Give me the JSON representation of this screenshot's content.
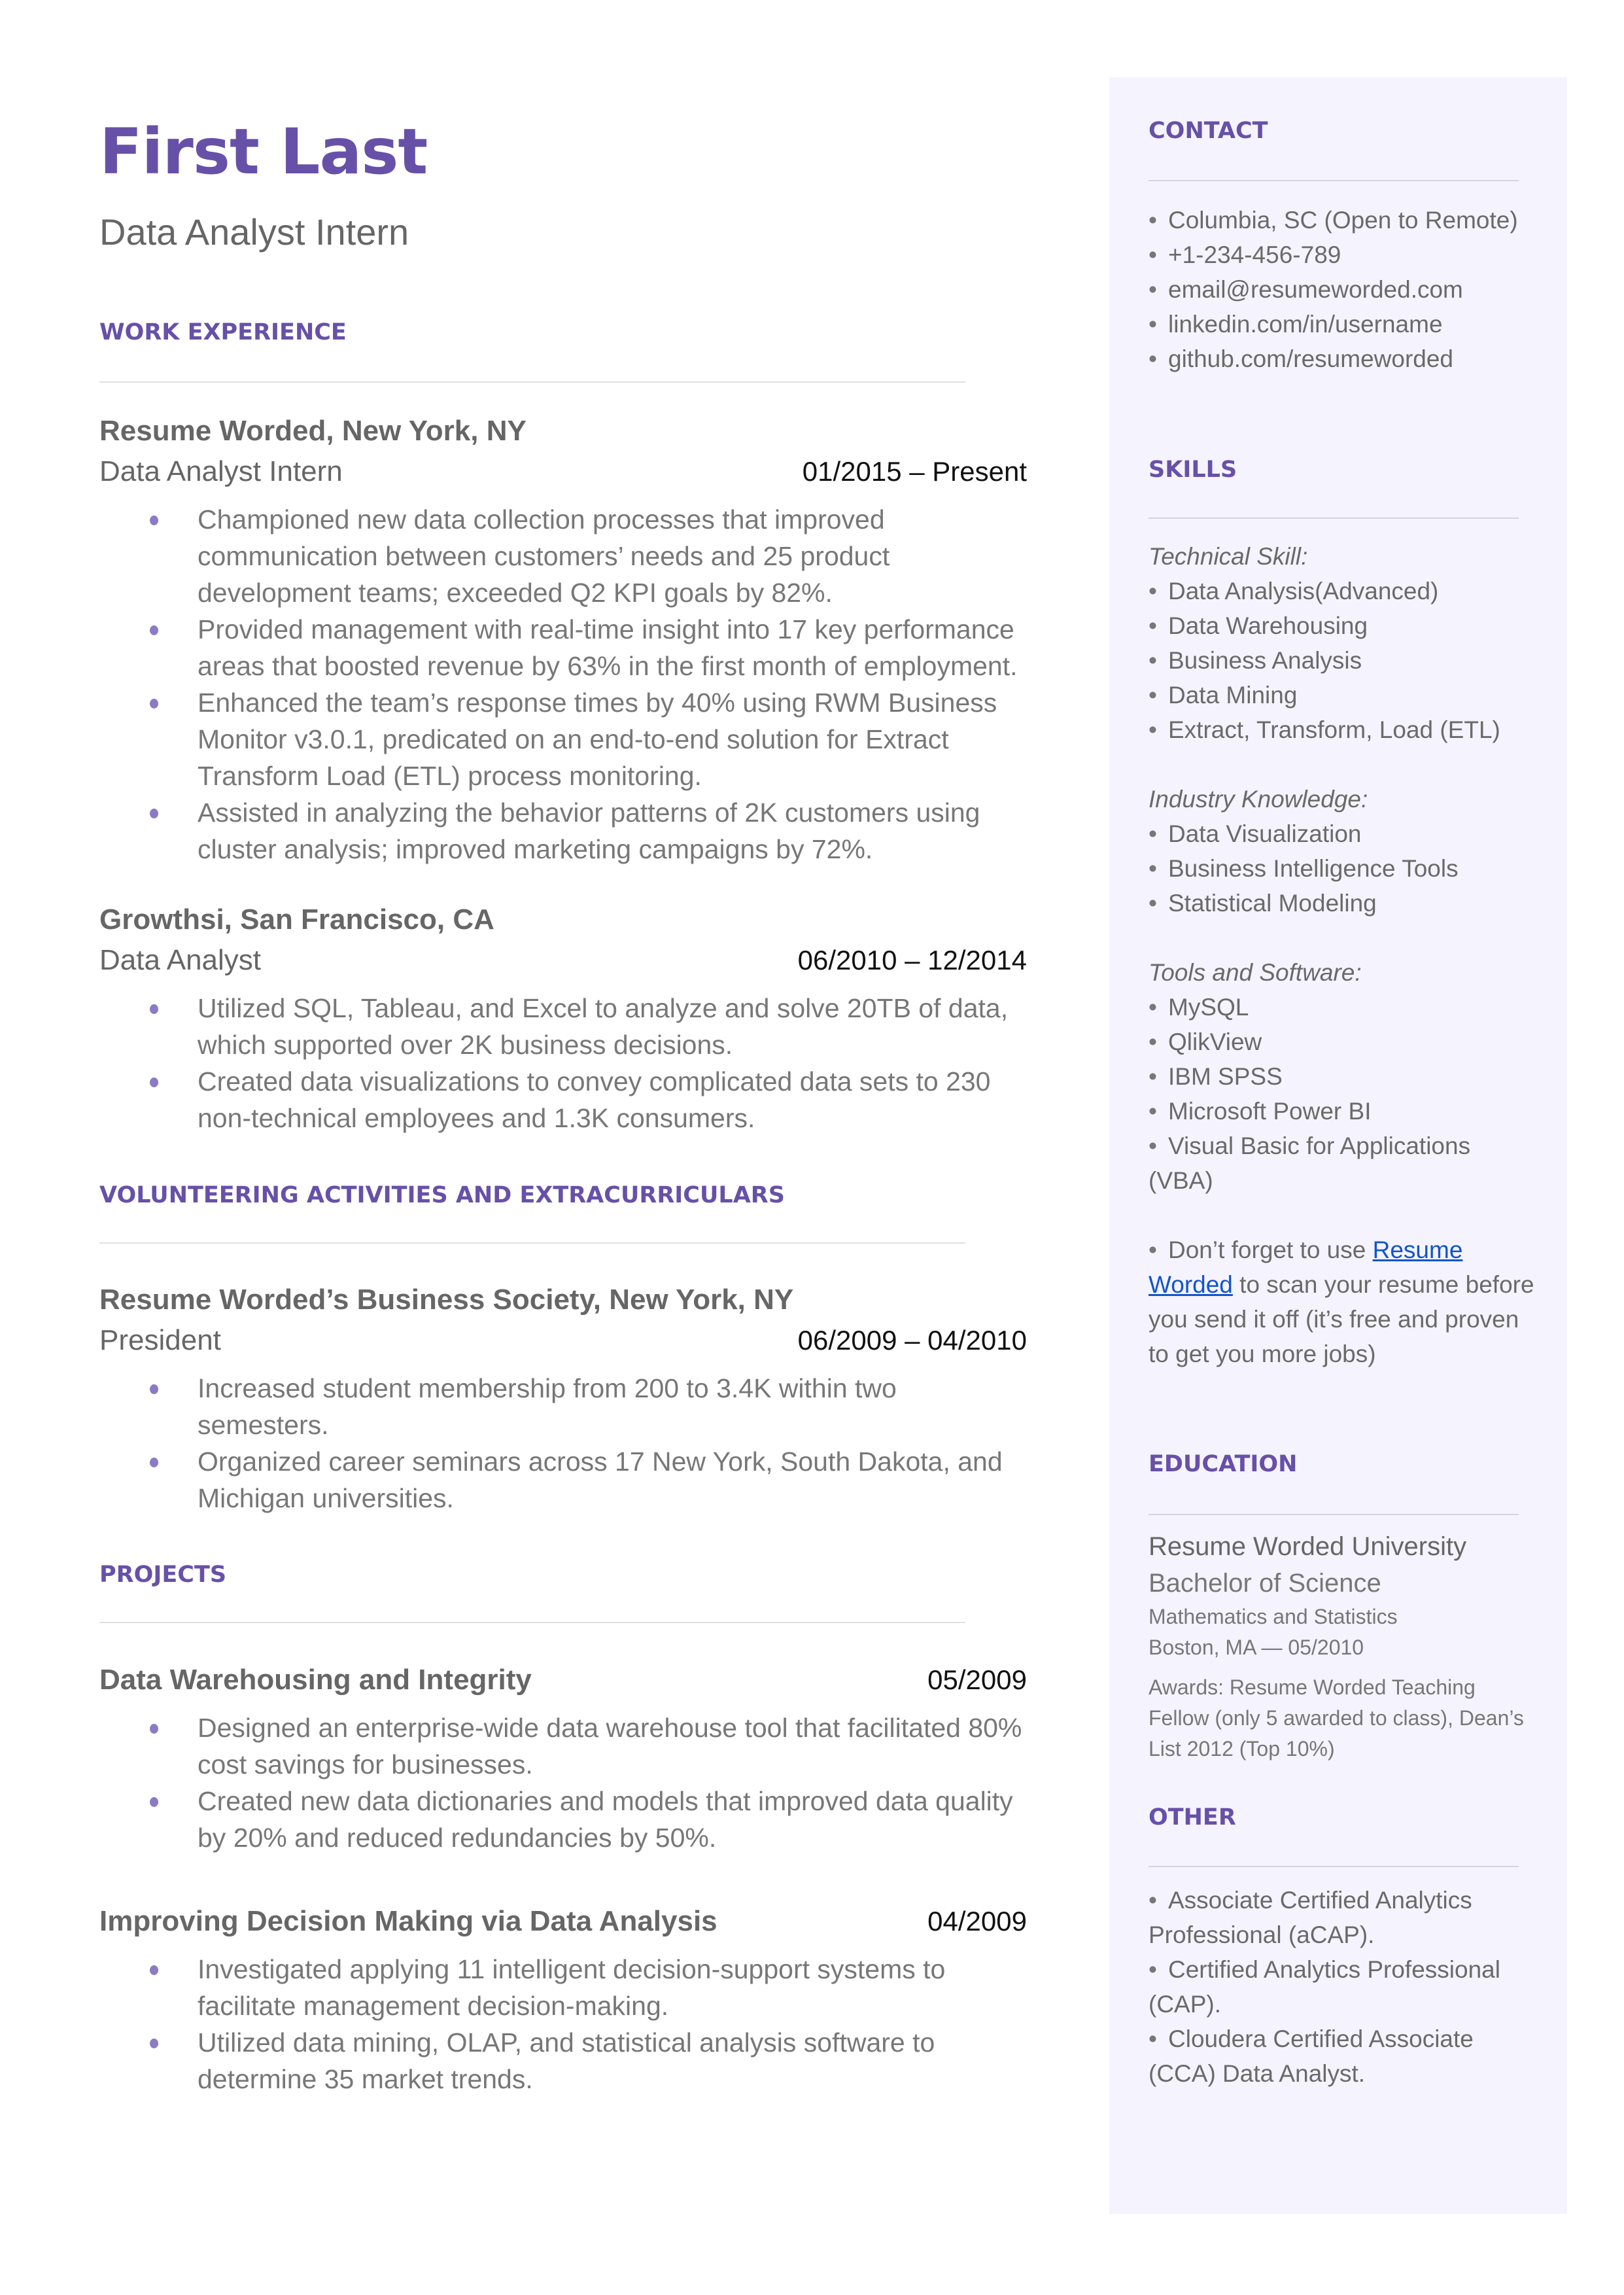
{
  "header": {
    "name": "First Last",
    "title": "Data Analyst Intern"
  },
  "colors": {
    "accent": "#6750a8",
    "bullet": "#8d7ac4",
    "panel_bg": "#f5f3fd",
    "body_text": "#666666",
    "link": "#1155cc"
  },
  "work_experience": {
    "heading": "WORK EXPERIENCE",
    "entries": [
      {
        "org": "Resume Worded, New York, NY",
        "position": "Data Analyst Intern",
        "dates": "01/2015 – Present",
        "bullets": [
          "Championed new data collection processes that improved communication between customers’ needs and 25 product development teams; exceeded Q2 KPI goals by 82%.",
          "Provided management with real-time insight into 17 key performance areas that boosted revenue by 63% in the first month of employment.",
          "Enhanced the team’s response times by 40% using RWM Business Monitor v3.0.1, predicated on an end-to-end solution for Extract Transform Load (ETL) process monitoring.",
          "Assisted in analyzing the behavior patterns of 2K customers using cluster analysis; improved marketing campaigns by 72%."
        ]
      },
      {
        "org": "Growthsi, San Francisco, CA",
        "position": "Data Analyst",
        "dates": "06/2010 – 12/2014",
        "bullets": [
          "Utilized SQL, Tableau, and Excel to analyze and solve 20TB of data, which supported over 2K business decisions.",
          "Created data visualizations to convey complicated data sets to 230 non-technical employees and 1.3K consumers."
        ]
      }
    ]
  },
  "volunteering": {
    "heading": "VOLUNTEERING ACTIVITIES AND EXTRACURRICULARS",
    "entries": [
      {
        "org": "Resume Worded’s Business Society, New York, NY",
        "position": "President",
        "dates": "06/2009 – 04/2010",
        "bullets": [
          "Increased student membership from 200 to 3.4K within two semesters.",
          "Organized career seminars across 17 New York, South Dakota, and Michigan universities."
        ]
      }
    ]
  },
  "projects": {
    "heading": "PROJECTS",
    "entries": [
      {
        "title": "Data Warehousing and Integrity",
        "date": "05/2009",
        "bullets": [
          "Designed an enterprise-wide data warehouse tool that facilitated 80% cost savings for businesses.",
          "Created new data dictionaries and models that improved data quality by 20% and reduced redundancies by 50%."
        ]
      },
      {
        "title": "Improving Decision Making via Data Analysis",
        "date": "04/2009",
        "bullets": [
          "Investigated applying 11 intelligent decision-support systems to facilitate management decision-making.",
          "Utilized data mining, OLAP, and statistical analysis software to determine 35 market trends."
        ]
      }
    ]
  },
  "sidebar": {
    "contact": {
      "heading": "CONTACT",
      "items": [
        "Columbia, SC (Open to Remote)",
        "+1-234-456-789",
        "email@resumeworded.com",
        "linkedin.com/in/username",
        "github.com/resumeworded"
      ]
    },
    "skills": {
      "heading": "SKILLS",
      "groups": [
        {
          "label": "Technical Skill:",
          "items": [
            "Data Analysis(Advanced)",
            "Data Warehousing",
            "Business Analysis",
            "Data Mining",
            "Extract, Transform, Load (ETL)"
          ]
        },
        {
          "label": "Industry Knowledge:",
          "items": [
            "Data Visualization",
            "Business Intelligence Tools",
            "Statistical Modeling"
          ]
        },
        {
          "label": "Tools and Software:",
          "items": [
            "MySQL",
            "QlikView",
            "IBM SPSS",
            "Microsoft Power BI",
            "Visual Basic for Applications (VBA)"
          ]
        }
      ],
      "tip": {
        "prefix": "Don’t forget to use ",
        "link_text": "Resume Worded",
        "suffix": " to scan your resume before you send it off (it’s free and proven to get you more jobs)"
      }
    },
    "education": {
      "heading": "EDUCATION",
      "school": "Resume Worded University",
      "degree": "Bachelor of Science",
      "major": "Mathematics and Statistics",
      "location_date": "Boston, MA — 05/2010",
      "awards": "Awards: Resume Worded Teaching Fellow (only 5 awarded to class), Dean’s List 2012 (Top 10%)"
    },
    "other": {
      "heading": "OTHER",
      "items": [
        "Associate Certified Analytics Professional (aCAP).",
        "Certified Analytics Professional (CAP).",
        "Cloudera Certified Associate (CCA) Data Analyst."
      ]
    }
  }
}
